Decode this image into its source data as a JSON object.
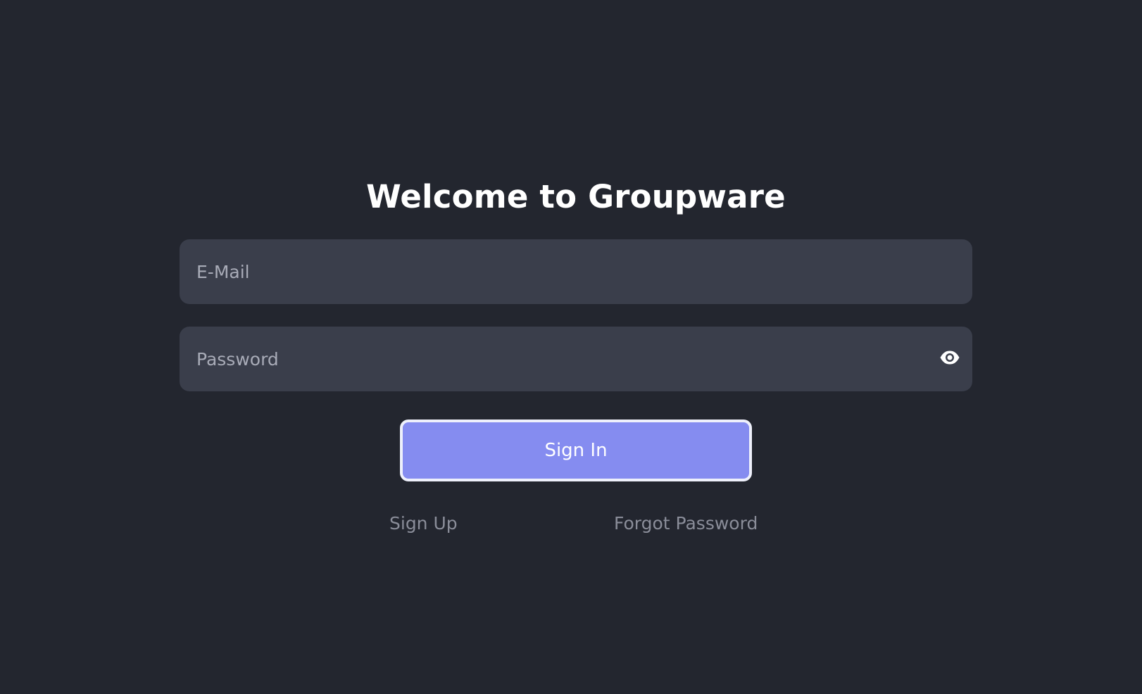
{
  "page": {
    "title": "Welcome to Groupware",
    "background_color": "#23262f"
  },
  "form": {
    "email_placeholder": "E-Mail",
    "email_value": "",
    "password_placeholder": "Password",
    "password_value": "",
    "password_toggle_icon": "eye-icon",
    "field_color": "#3a3e4b"
  },
  "actions": {
    "sign_in_label": "Sign In",
    "sign_in_color": "#858cf0",
    "sign_up_label": "Sign Up",
    "forgot_password_label": "Forgot Password"
  }
}
